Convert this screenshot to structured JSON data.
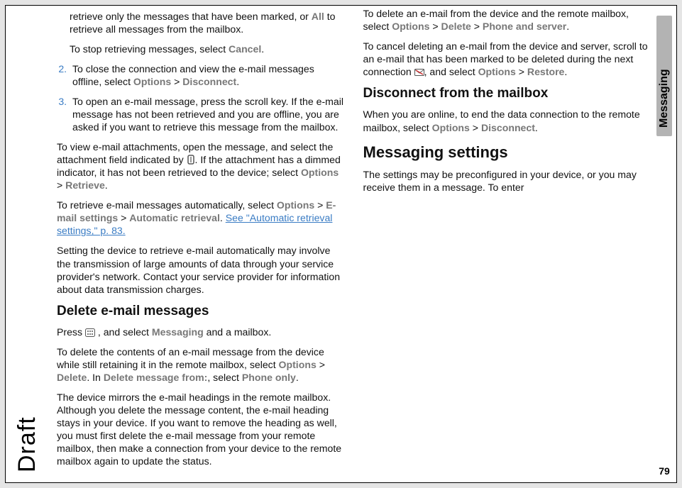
{
  "side_tab": "Messaging",
  "page_number": "79",
  "draft_label": "Draft",
  "col1": {
    "para1_a": "retrieve only the messages that have been marked, or ",
    "para1_all": "All",
    "para1_b": " to retrieve all messages from the mailbox.",
    "para2_a": "To stop retrieving messages, select ",
    "para2_cancel": "Cancel",
    "para2_b": ".",
    "li2_a": "To close the connection and view the e-mail messages offline, select ",
    "li2_options": "Options",
    "li2_gt": " > ",
    "li2_disconnect": "Disconnect",
    "li2_b": ".",
    "li3": "To open an e-mail message, press the scroll key. If the e-mail message has not been retrieved and you are offline, you are asked if you want to retrieve this message from the mailbox.",
    "p3_a": "To view e-mail attachments, open the message, and select the attachment field indicated by ",
    "p3_b": ". If the attachment has a dimmed indicator, it has not been retrieved to the device; select ",
    "p3_options": "Options",
    "p3_gt": " > ",
    "p3_retrieve": "Retrieve",
    "p3_c": ".",
    "p4_a": "To retrieve e-mail messages automatically, select ",
    "p4_options": "Options",
    "p4_gt1": " > ",
    "p4_email": "E-mail settings",
    "p4_gt2": " > ",
    "p4_auto": "Automatic retrieval",
    "p4_dot": ". ",
    "p4_link": "See \"Automatic retrieval settings,\" p. 83.",
    "p5": "Setting the device to retrieve e-mail automatically may involve the transmission of large amounts of data through your service provider's network. Contact your service provider for information about data transmission charges.",
    "h_delete": "Delete e-mail messages",
    "p6_a": "Press ",
    "p6_b": " , and select ",
    "p6_msg": "Messaging",
    "p6_c": " and a mailbox."
  },
  "col2": {
    "p1_a": "To delete the contents of an e-mail message from the device while still retaining it in the remote mailbox, select ",
    "p1_options": "Options",
    "p1_gt": " > ",
    "p1_delete": "Delete",
    "p1_b": ". In ",
    "p1_delfrom": "Delete message from:",
    "p1_c": ", select ",
    "p1_phoneonly": "Phone only",
    "p1_d": ".",
    "p2": "The device mirrors the e-mail headings in the remote mailbox. Although you delete the message content, the e-mail heading stays in your device. If you want to remove the heading as well, you must first delete the e-mail message from your remote mailbox, then make a connection from your device to the remote mailbox again to update the status.",
    "p3_a": "To delete an e-mail from the device and the remote mailbox, select ",
    "p3_options": "Options",
    "p3_gt1": " > ",
    "p3_delete": "Delete",
    "p3_gt2": " > ",
    "p3_phoneserver": "Phone and server",
    "p3_b": ".",
    "p4_a": "To cancel deleting an e-mail from the device and server, scroll to an e-mail that has been marked to be deleted during the next connection ",
    "p4_b": ", and select ",
    "p4_options": "Options",
    "p4_gt": " > ",
    "p4_restore": "Restore",
    "p4_c": ".",
    "h_disconnect": "Disconnect from the mailbox",
    "p5_a": "When you are online, to end the data connection to the remote mailbox, select ",
    "p5_options": "Options",
    "p5_gt": " > ",
    "p5_disconnect": "Disconnect",
    "p5_b": ".",
    "h_settings": "Messaging settings",
    "p6": "The settings may be preconfigured in your device, or you may receive them in a message. To enter"
  }
}
